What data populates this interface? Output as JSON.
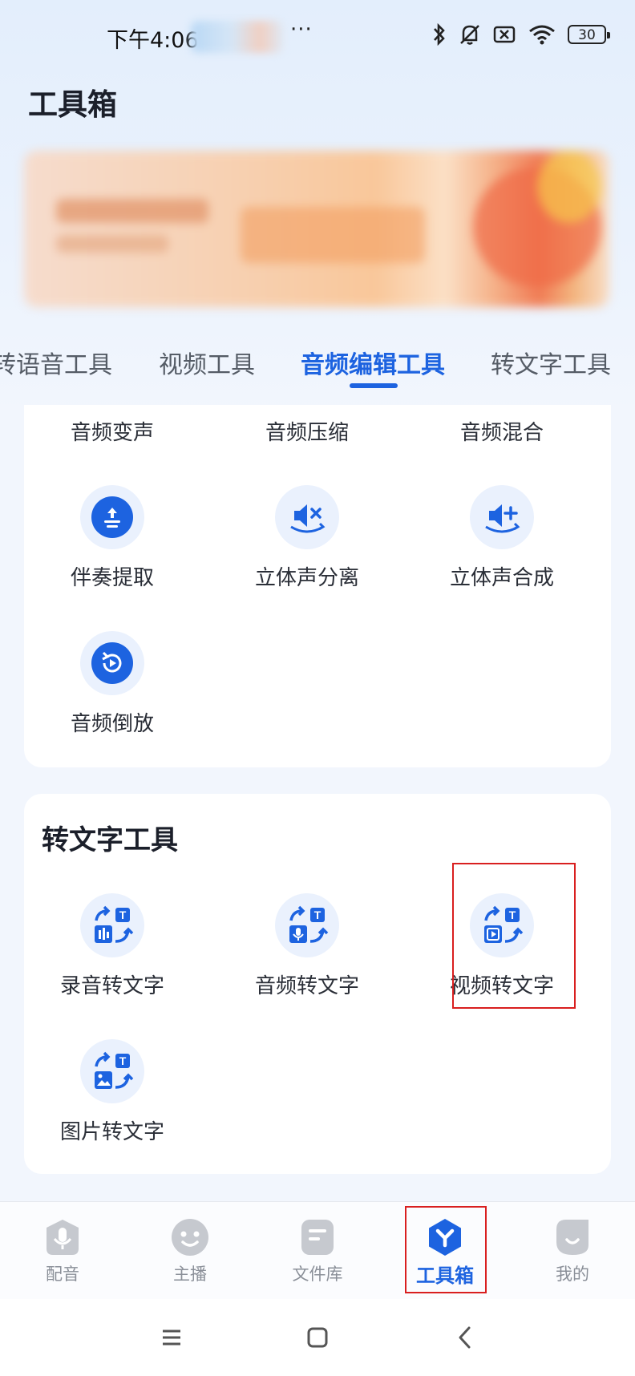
{
  "status_bar": {
    "time": "下午4:06",
    "more": "···",
    "battery": "30"
  },
  "page_title": "工具箱",
  "tabs": [
    {
      "label": "转语音工具",
      "active": false
    },
    {
      "label": "视频工具",
      "active": false
    },
    {
      "label": "音频编辑工具",
      "active": true
    },
    {
      "label": "转文字工具",
      "active": false
    }
  ],
  "audio_edit_section": {
    "top_row_labels": [
      "音频变声",
      "音频压缩",
      "音频混合"
    ],
    "tools": [
      {
        "label": "伴奏提取",
        "icon": "accompaniment-extract-icon"
      },
      {
        "label": "立体声分离",
        "icon": "stereo-split-icon"
      },
      {
        "label": "立体声合成",
        "icon": "stereo-merge-icon"
      },
      {
        "label": "音频倒放",
        "icon": "audio-reverse-icon"
      }
    ]
  },
  "to_text_section": {
    "title": "转文字工具",
    "tools": [
      {
        "label": "录音转文字",
        "icon": "recording-to-text-icon"
      },
      {
        "label": "音频转文字",
        "icon": "audio-to-text-icon"
      },
      {
        "label": "视频转文字",
        "icon": "video-to-text-icon"
      },
      {
        "label": "图片转文字",
        "icon": "image-to-text-icon"
      }
    ]
  },
  "bottom_nav": [
    {
      "label": "配音",
      "icon": "dubbing-icon",
      "active": false
    },
    {
      "label": "主播",
      "icon": "anchor-icon",
      "active": false
    },
    {
      "label": "文件库",
      "icon": "file-library-icon",
      "active": false
    },
    {
      "label": "工具箱",
      "icon": "toolbox-icon",
      "active": true
    },
    {
      "label": "我的",
      "icon": "profile-icon",
      "active": false
    }
  ],
  "colors": {
    "accent": "#1d63e0",
    "highlight_box": "#d91f1f",
    "icon_bg": "#eaf1fd"
  }
}
